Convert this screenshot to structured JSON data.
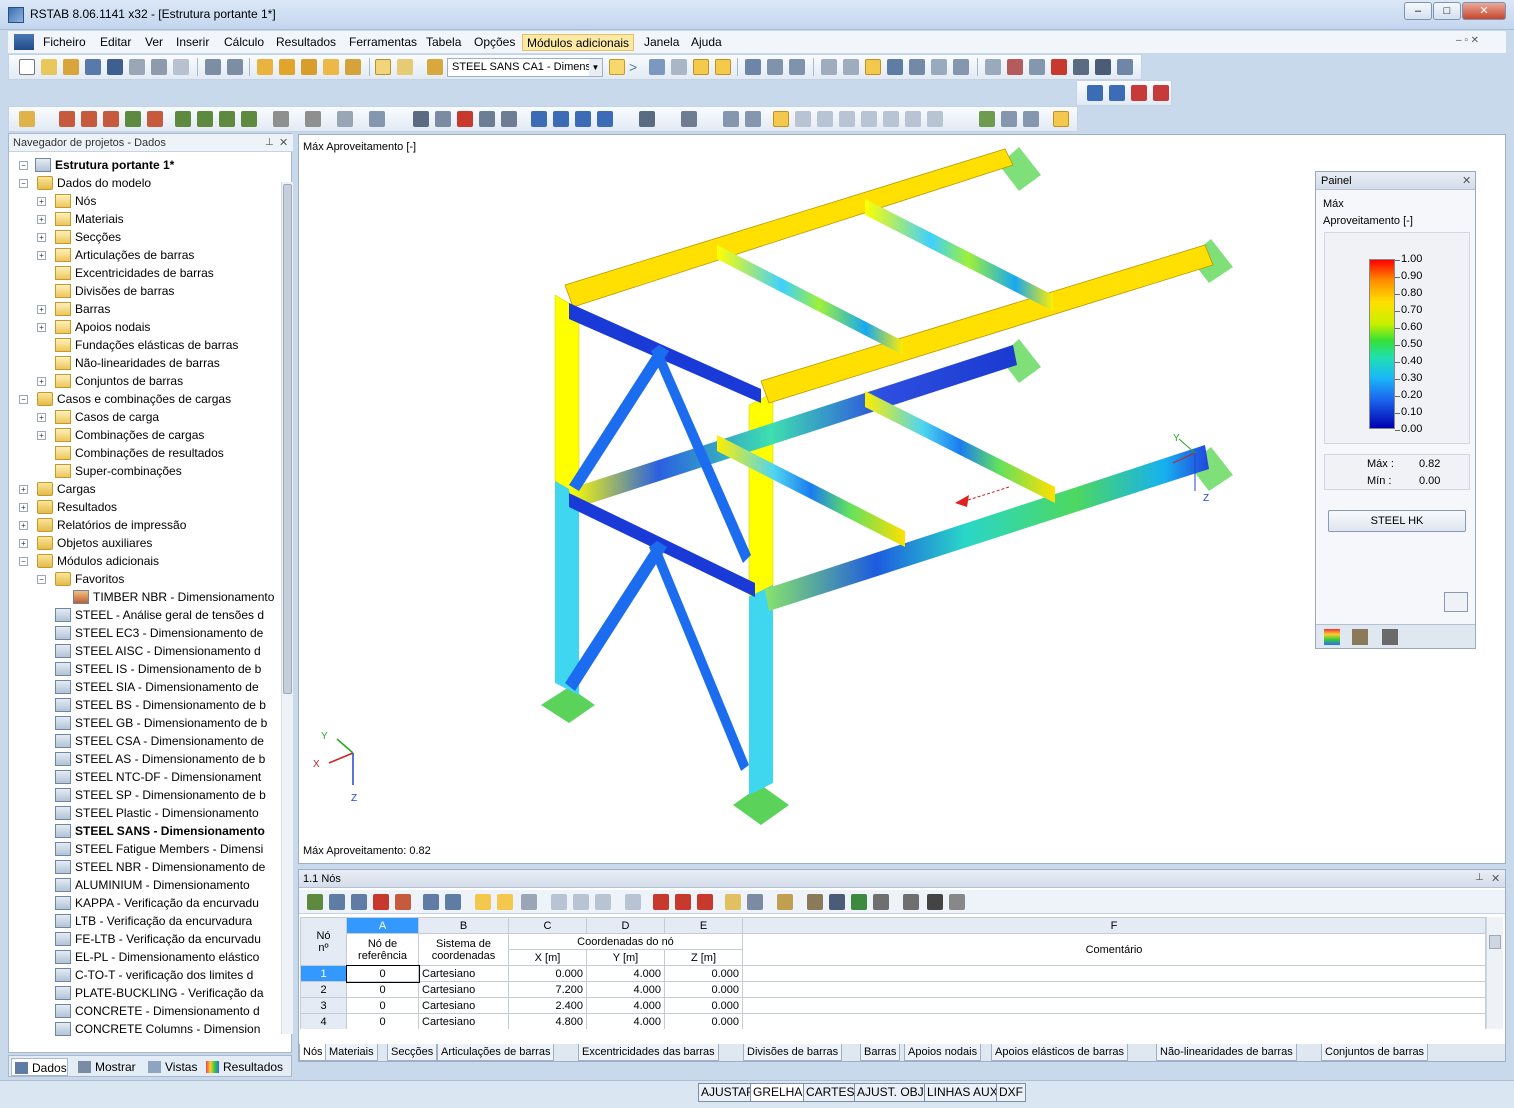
{
  "window": {
    "title": "RSTAB 8.06.1141 x32 - [Estrutura portante 1*]",
    "minimize": "‒",
    "maximize": "□",
    "close": "✕"
  },
  "menu": [
    "Ficheiro",
    "Editar",
    "Ver",
    "Inserir",
    "Cálculo",
    "Resultados",
    "Ferramentas",
    "Tabela",
    "Opções",
    "Módulos adicionais",
    "Janela",
    "Ajuda"
  ],
  "toolbar": {
    "module_select": "STEEL SANS CA1 - Dimensi"
  },
  "navigator": {
    "title": "Navegador de projetos - Dados",
    "root": "Estrutura portante 1*",
    "items": [
      "Dados do modelo",
      "Nós",
      "Materiais",
      "Secções",
      "Articulações de barras",
      "Excentricidades de barras",
      "Divisões de barras",
      "Barras",
      "Apoios nodais",
      "Fundações elásticas de barras",
      "Não-linearidades de barras",
      "Conjuntos de barras",
      "Casos e combinações de cargas",
      "Casos de carga",
      "Combinações de cargas",
      "Combinações de resultados",
      "Super-combinações",
      "Cargas",
      "Resultados",
      "Relatórios de impressão",
      "Objetos auxiliares",
      "Módulos adicionais",
      "Favoritos",
      "TIMBER NBR - Dimensionamento",
      "STEEL - Análise geral de tensões d",
      "STEEL EC3 - Dimensionamento de",
      "STEEL AISC - Dimensionamento d",
      "STEEL IS - Dimensionamento de b",
      "STEEL SIA - Dimensionamento de",
      "STEEL BS - Dimensionamento de b",
      "STEEL GB - Dimensionamento de b",
      "STEEL CSA - Dimensionamento de",
      "STEEL AS - Dimensionamento de b",
      "STEEL NTC-DF - Dimensionament",
      "STEEL SP - Dimensionamento de b",
      "STEEL Plastic - Dimensionamento",
      "STEEL SANS - Dimensionamento",
      "STEEL Fatigue Members - Dimensi",
      "STEEL NBR - Dimensionamento de",
      "ALUMINIUM - Dimensionamento",
      "KAPPA - Verificação da encurvadu",
      "LTB - Verificação da encurvadura",
      "FE-LTB - Verificação da encurvadu",
      "EL-PL - Dimensionamento elástico",
      "C-TO-T - verificação dos limites d",
      "PLATE-BUCKLING - Verificação da",
      "CONCRETE - Dimensionamento d",
      "CONCRETE Columns - Dimension"
    ],
    "tabs": [
      "Dados",
      "Mostrar",
      "Vistas",
      "Resultados"
    ]
  },
  "view": {
    "top_label": "Máx Aproveitamento [-]",
    "bottom_label": "Máx Aproveitamento: 0.82",
    "axes": {
      "x": "X",
      "y": "Y",
      "z": "Z"
    }
  },
  "panel": {
    "title": "Painel",
    "heading1": "Máx",
    "heading2": "Aproveitamento [-]",
    "scale": [
      "1.00",
      "0.90",
      "0.80",
      "0.70",
      "0.60",
      "0.50",
      "0.40",
      "0.30",
      "0.20",
      "0.10",
      "0.00"
    ],
    "max_label": "Máx  :",
    "max_value": "0.82",
    "min_label": "Mín  :",
    "min_value": "0.00",
    "button": "STEEL HK"
  },
  "grid": {
    "title": "1.1 Nós",
    "col_letters": [
      "A",
      "B",
      "C",
      "D",
      "E",
      "F"
    ],
    "h_no1": "Nó",
    "h_no2": "nº",
    "h_ref1": "Nó de",
    "h_ref2": "referência",
    "h_sys1": "Sistema de",
    "h_sys2": "coordenadas",
    "h_coord": "Coordenadas do nó",
    "h_x": "X [m]",
    "h_y": "Y [m]",
    "h_z": "Z [m]",
    "h_comment": "Comentário",
    "rows": [
      [
        "1",
        "0",
        "Cartesiano",
        "0.000",
        "4.000",
        "0.000"
      ],
      [
        "2",
        "0",
        "Cartesiano",
        "7.200",
        "4.000",
        "0.000"
      ],
      [
        "3",
        "0",
        "Cartesiano",
        "2.400",
        "4.000",
        "0.000"
      ],
      [
        "4",
        "0",
        "Cartesiano",
        "4.800",
        "4.000",
        "0.000"
      ]
    ],
    "sheet_tabs": [
      "Nós",
      "Materiais",
      "Secções",
      "Articulações de barras",
      "Excentricidades das barras",
      "Divisões de barras",
      "Barras",
      "Apoios nodais",
      "Apoios elásticos de barras",
      "Não-linearidades de barras",
      "Conjuntos de barras"
    ]
  },
  "status": [
    "AJUSTAR",
    "GRELHA",
    "CARTES",
    "AJUST. OBJ.",
    "LINHAS AUX.",
    "DXF"
  ],
  "colors": {
    "accent": "#fde9a6",
    "selected_row": "#3399ff"
  }
}
